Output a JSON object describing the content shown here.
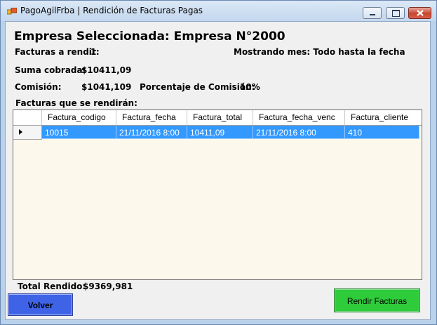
{
  "window": {
    "title": "PagoAgilFrba | Rendición de Facturas Pagas",
    "controls": {
      "minimize": "minimize-icon",
      "maximize": "maximize-icon",
      "close": "close-icon"
    }
  },
  "header": {
    "empresa": "Empresa Seleccionada: Empresa N°2000",
    "facturas_label": "Facturas a rendir:",
    "facturas_value": "1",
    "mostrando": "Mostrando mes: Todo hasta la fecha",
    "suma_label": "Suma cobrada:",
    "suma_value": "$10411,09",
    "comision_label": "Comisión:",
    "comision_value": "$1041,109",
    "porcentaje_label": "Porcentaje de Comisión:",
    "porcentaje_value": "10%"
  },
  "grid": {
    "caption": "Facturas que se rendirán:",
    "columns": [
      "Factura_codigo",
      "Factura_fecha",
      "Factura_total",
      "Factura_fecha_venc",
      "Factura_cliente"
    ],
    "rows": [
      [
        "10015",
        "21/11/2016 8:00",
        "10411,09",
        "21/11/2016 8:00",
        "410"
      ]
    ]
  },
  "footer": {
    "total_label": "Total Rendido:",
    "total_value": "$9369,981",
    "volver": "Volver",
    "rendir": "Rendir Facturas"
  },
  "colors": {
    "volver_button": "#3f63e6",
    "rendir_button": "#2ecb3a",
    "selection": "#3399ff"
  }
}
